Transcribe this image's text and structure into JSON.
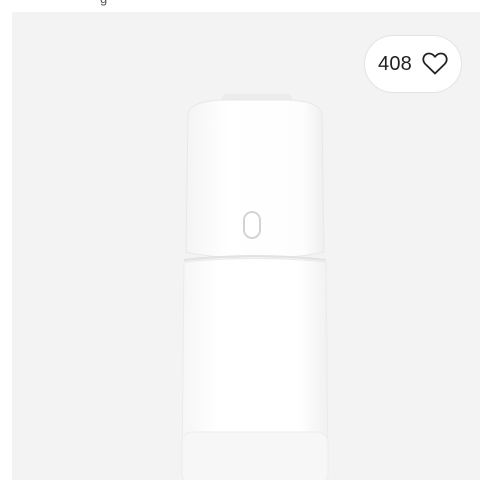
{
  "header": {
    "partial_text": "g"
  },
  "likes": {
    "count": "408",
    "icon": "heart-outline-icon"
  },
  "product": {
    "image_name": "white-diaper-pail-image"
  }
}
